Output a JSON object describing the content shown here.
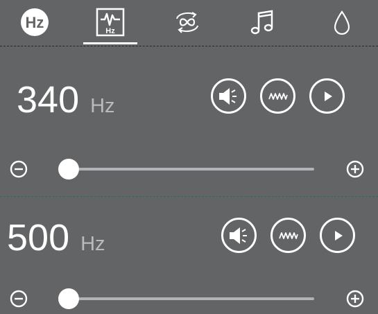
{
  "tabs": [
    {
      "id": "hz",
      "icon": "hz-badge-icon",
      "label": "Hz",
      "active": false
    },
    {
      "id": "signal",
      "icon": "signal-hz-icon",
      "label": "Hz",
      "active": true
    },
    {
      "id": "loop",
      "icon": "infinity-loop-icon",
      "active": false
    },
    {
      "id": "music",
      "icon": "music-note-icon",
      "active": false
    },
    {
      "id": "drop",
      "icon": "water-drop-icon",
      "active": false
    }
  ],
  "tones": [
    {
      "value": "340",
      "unit": "Hz",
      "slider_fraction": 0.02
    },
    {
      "value": "500",
      "unit": "Hz",
      "slider_fraction": 0.02
    }
  ],
  "controls": {
    "speaker_icon": "speaker-icon",
    "wave_icon": "waveform-icon",
    "play_icon": "play-icon",
    "minus_icon": "minus-circle-icon",
    "plus_icon": "plus-circle-icon"
  },
  "colors": {
    "background": "#636465",
    "foreground": "#ffffff",
    "unit_text": "#b9bbbd",
    "track": "#b0b3b8",
    "divider": "#2f6b4e"
  }
}
